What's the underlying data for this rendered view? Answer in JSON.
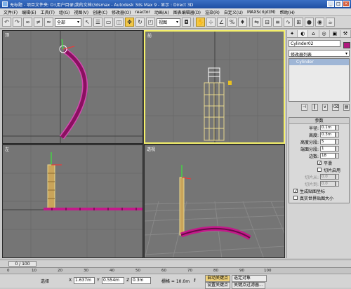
{
  "window": {
    "icon": "3dsmax-app-icon",
    "title": "无标题  - 项目文件夹: D:\\用户目录\\我的文档\\3dsmax  - Autodesk 3ds Max 9  - 显示 : Direct 3D",
    "buttons": [
      "_",
      "□",
      "×"
    ]
  },
  "menu": [
    "文件(F)",
    "编辑(E)",
    "工具(T)",
    "组(G)",
    "视图(V)",
    "创建(C)",
    "修改器(O)",
    "reactor",
    "动画(A)",
    "图表编辑器(D)",
    "渲染(R)",
    "自定义(U)",
    "MAXScript(M)",
    "帮助(H)"
  ],
  "toolbar": {
    "selection_filter": "全部",
    "coord_system": "视图",
    "icons": [
      "undo-icon",
      "redo-icon",
      "link-icon",
      "unlink-icon",
      "bind-icon",
      "select-icon",
      "select-by-name-icon",
      "rect-region-icon",
      "window-crossing-icon",
      "move-icon",
      "rotate-icon",
      "scale-icon",
      "pivot-icon",
      "manipulate-icon",
      "snap-icon",
      "angle-snap-icon",
      "percent-snap-icon",
      "spinner-snap-icon",
      "mirror-icon",
      "align-icon",
      "layer-icon",
      "curve-editor-icon",
      "schematic-icon",
      "material-icon",
      "render-setup-icon",
      "quick-render-icon"
    ]
  },
  "viewports": [
    {
      "label": "顶",
      "active": false
    },
    {
      "label": "前",
      "active": true
    },
    {
      "label": "左",
      "active": false
    },
    {
      "label": "透视",
      "active": false
    }
  ],
  "panel": {
    "tabs": [
      "create-tab-icon",
      "modify-tab-icon",
      "hierarchy-tab-icon",
      "motion-tab-icon",
      "display-tab-icon",
      "utilities-tab-icon"
    ],
    "object_name": "Cylinder02",
    "object_color": "#b0187e",
    "modifier_list": "修改器列表",
    "stack_item": "Cylinder",
    "params": {
      "title": "参数",
      "fields": [
        {
          "label": "半径:",
          "value": "0.1m"
        },
        {
          "label": "高度:",
          "value": "0.3m"
        },
        {
          "label": "高度分段:",
          "value": "5"
        },
        {
          "label": "端面分段:",
          "value": "1"
        },
        {
          "label": "边数:",
          "value": "18"
        }
      ],
      "smooth_label": "平滑",
      "slice_on_label": "切片启用",
      "slice_from_label": "切片从:",
      "slice_from_value": "0.0",
      "slice_to_label": "切片到:",
      "slice_to_value": "0.0",
      "gen_map_label": "生成贴图坐标",
      "real_world_label": "真实世界贴图大小"
    }
  },
  "timeline": {
    "frame_display": "0 / 100",
    "ticks": [
      "0",
      "10",
      "20",
      "30",
      "40",
      "50",
      "60",
      "70",
      "80",
      "90",
      "100"
    ]
  },
  "status": {
    "selected": "选择",
    "x_label": "X",
    "x_value": "1.637m",
    "y_label": "Y",
    "y_value": "0.554m",
    "z_label": "Z",
    "z_value": "0.3m",
    "grid": "栅格 = 10.0m",
    "auto_key": "自动关键点",
    "set_key": "设置关键点",
    "selection_set": "选定对象",
    "key_filters": "关键点过滤器..."
  },
  "colors": {
    "accent_active": "#f5f06a",
    "selected_object": "#c21a8a"
  }
}
